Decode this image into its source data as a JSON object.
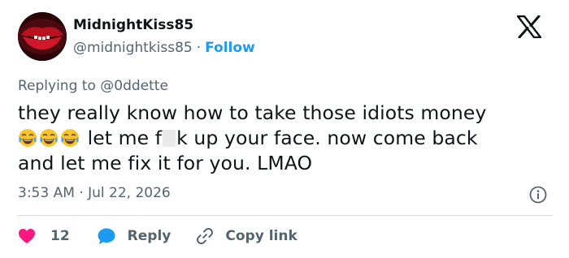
{
  "tweet": {
    "author": {
      "display_name": "MidnightKiss85",
      "handle": "@midnightkiss85",
      "separator": "·",
      "follow_label": "Follow"
    },
    "replying_prefix": "Replying to ",
    "replying_to": "@0ddette",
    "text": {
      "line1": "they really know how to take those idiots money",
      "line2_before_censor": " let me f",
      "line2_after_censor": "k up your face. now come back",
      "line3": "and let me fix it for you. LMAO"
    },
    "emoji_count": 3,
    "timestamp": "3:53 AM · Jul 22, 2026",
    "actions": {
      "like_count": "12",
      "reply_label": "Reply",
      "copy_label": "Copy link"
    }
  },
  "icons": {
    "logo": "x-logo-icon",
    "info": "info-icon",
    "like": "heart-icon",
    "reply": "speech-bubble-icon",
    "copy": "link-icon",
    "emoji": "tears-of-joy-emoji"
  },
  "colors": {
    "text": "#0f1419",
    "secondary": "#536471",
    "link": "#1d9bf0",
    "like": "#f91880",
    "divider": "#cfd9de",
    "emoji": "#f7c52b"
  }
}
